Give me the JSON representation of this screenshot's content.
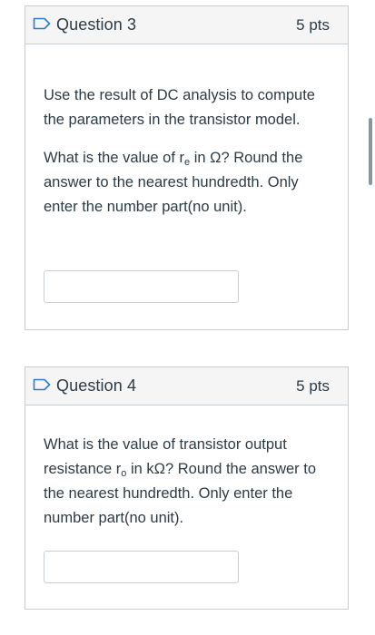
{
  "questions": [
    {
      "title": "Question 3",
      "points": "5 pts",
      "paragraph1": "Use the result of DC analysis to compute the parameters in the transistor model.",
      "p2_before": "What is the value of r",
      "p2_sub": "e",
      "p2_after": " in Ω? Round the answer to the nearest hundredth. Only enter the number part(no unit).",
      "answer_value": "",
      "answer_placeholder": ""
    },
    {
      "title": "Question 4",
      "points": "5 pts",
      "p1_before": "What is the value of transistor output resistance r",
      "p1_sub": "o",
      "p1_after": " in kΩ? Round the answer to the nearest hundredth. Only enter the number part(no unit).",
      "answer_value": "",
      "answer_placeholder": ""
    }
  ],
  "icons": {
    "flag": "flag-outline-icon"
  },
  "colors": {
    "flag": "#2d7ad6",
    "text": "#2d3b45",
    "header_bg": "#f5f5f5",
    "border": "#c7cdd1"
  }
}
